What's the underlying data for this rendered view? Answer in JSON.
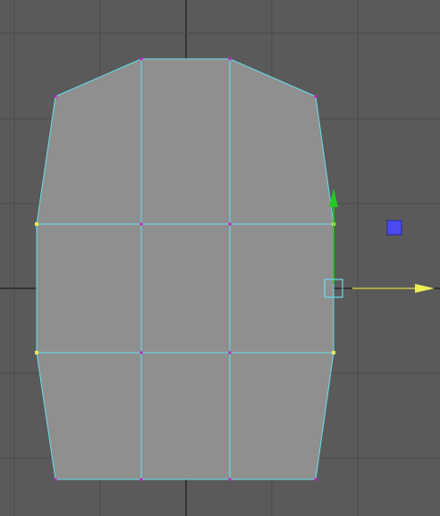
{
  "viewport": {
    "background": "#5a5a5a",
    "grid_color": "#4a4a4a",
    "axis_color": "#333333"
  },
  "mesh": {
    "face_color": "#8f8f8f",
    "edge_color": "#66e0ee",
    "vertex_color": "#c21fc2",
    "selected_vertex_color": "#e8e85a"
  },
  "gizmo": {
    "y_axis_color": "#22cc22",
    "x_axis_color": "#eeee55",
    "center_color": "#66e0ee",
    "z_handle_color": "#4a4aee",
    "y_handle_icon": "up-arrow-icon",
    "x_handle_icon": "right-arrow-icon",
    "z_handle_icon": "square-handle-icon"
  }
}
